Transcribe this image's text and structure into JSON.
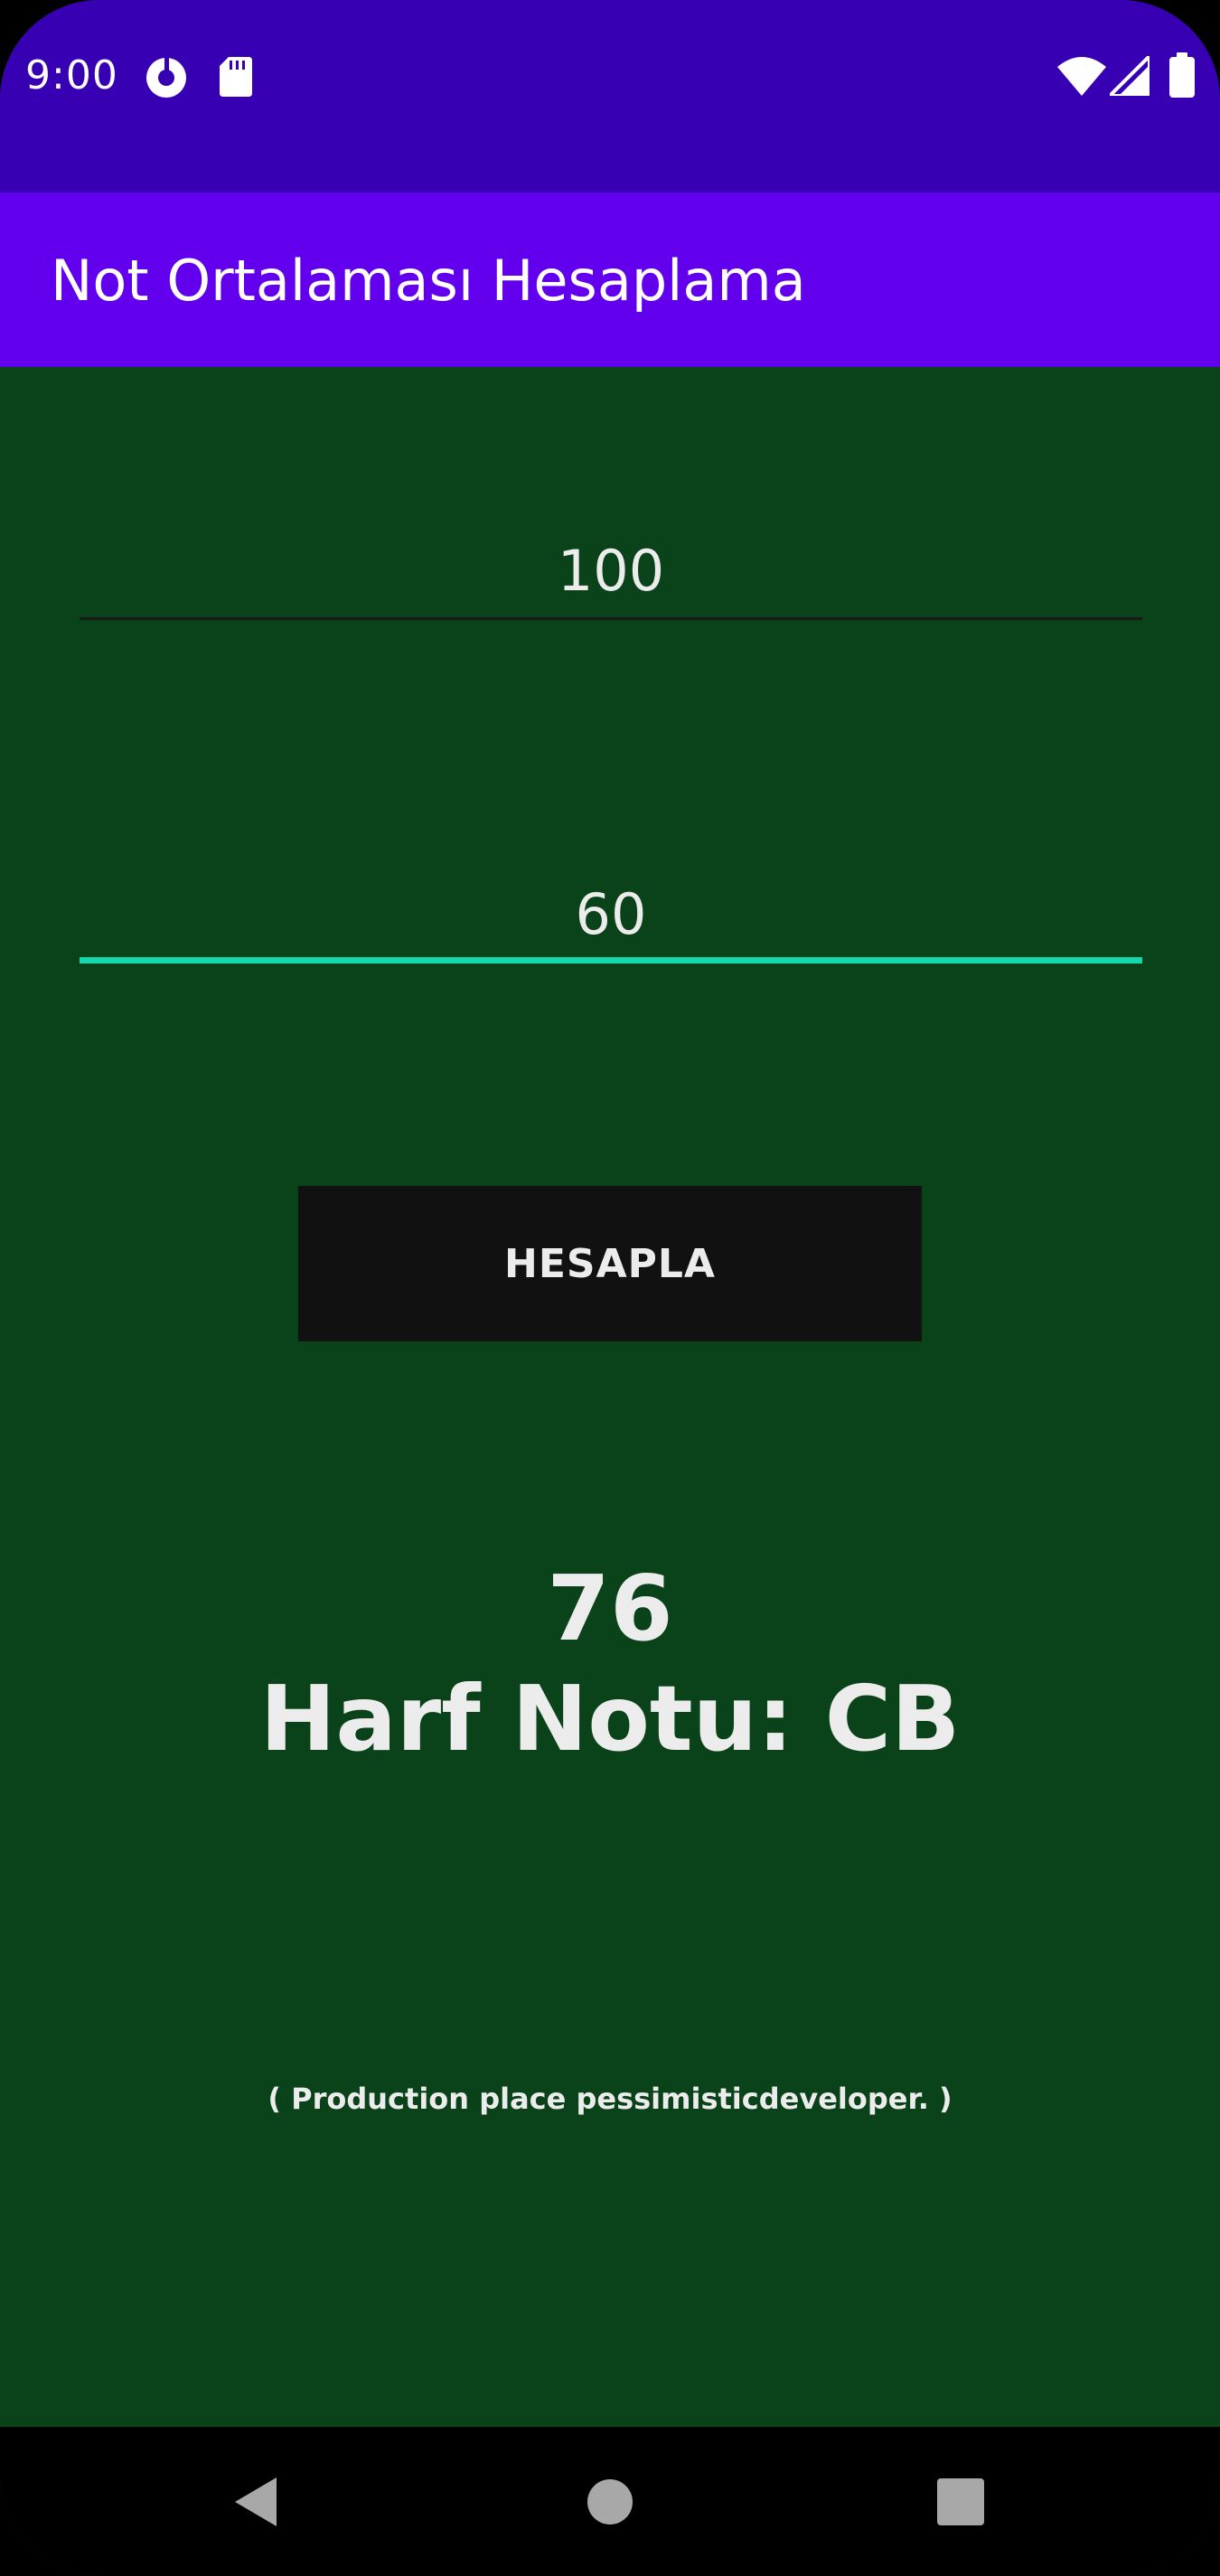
{
  "status_bar": {
    "time": "9:00",
    "left_icons": [
      "data-saver-icon",
      "sd-card-icon"
    ],
    "right_icons": [
      "wifi-icon",
      "cell-signal-icon",
      "battery-icon"
    ]
  },
  "app_bar": {
    "title": "Not Ortalaması Hesaplama"
  },
  "form": {
    "first_grade_value": "100",
    "second_grade_value": "60",
    "focused_field": "second",
    "calculate_label": "HESAPLA"
  },
  "result": {
    "average": "76",
    "letter_grade": "Harf Notu: CB"
  },
  "footer": {
    "credit": "( Production place pessimisticdeveloper. )"
  },
  "nav_bar": {
    "buttons": [
      "back-icon",
      "home-icon",
      "recents-icon"
    ]
  },
  "colors": {
    "status_bar": "#3700b3",
    "app_bar": "#6200ee",
    "background": "#0a4219",
    "accent": "#14d8b0",
    "button": "#111111",
    "text": "#ececec"
  }
}
